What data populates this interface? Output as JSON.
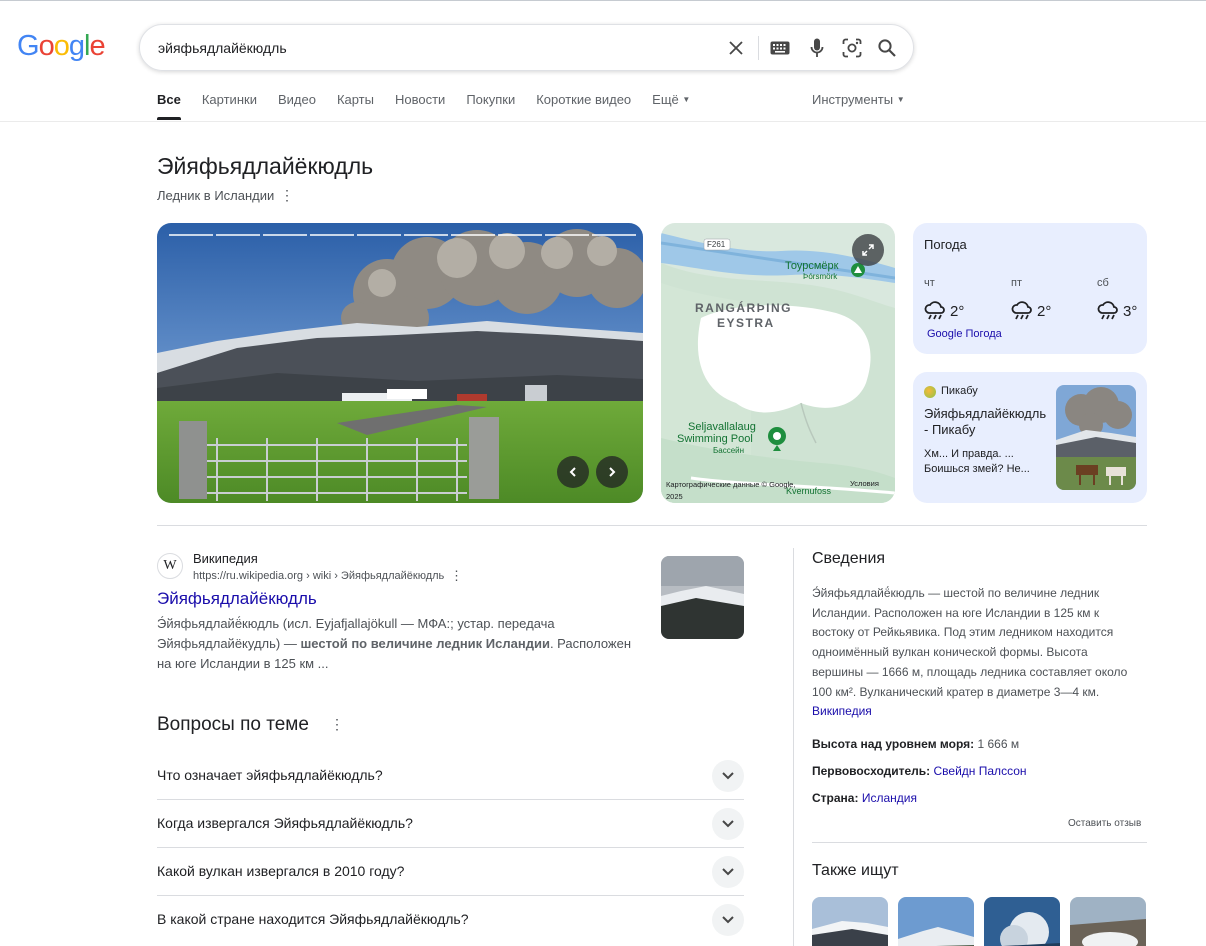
{
  "logo": {
    "letters": [
      "G",
      "o",
      "o",
      "g",
      "l",
      "e"
    ],
    "colors": [
      "#4285F4",
      "#EA4335",
      "#FBBC05",
      "#4285F4",
      "#34A853",
      "#EA4335"
    ]
  },
  "search": {
    "query": "эйяфьядлайёкюдль"
  },
  "tabs": [
    "Все",
    "Картинки",
    "Видео",
    "Карты",
    "Новости",
    "Покупки",
    "Короткие видео",
    "Ещё"
  ],
  "tools_label": "Инструменты",
  "knowledge_panel": {
    "title": "Эйяфьядлайёкюдль",
    "subtitle": "Ледник в Исландии"
  },
  "map": {
    "road_label": "F261",
    "place_ru": "Тоурсмёрк",
    "place_is": "Þórsmörk",
    "region_line1": "RANGÁRÞING",
    "region_line2": "EYSTRA",
    "pool_line1": "Seljavallalaug",
    "pool_line2": "Swimming Pool",
    "pool_type": "Бассейн",
    "waterfall": "Kvernufoss",
    "attribution": "Картографические данные © Google, 2025",
    "terms": "Условия"
  },
  "weather": {
    "title": "Погода",
    "days": [
      {
        "day": "чт",
        "temp": "2°"
      },
      {
        "day": "пт",
        "temp": "2°"
      },
      {
        "day": "сб",
        "temp": "3°"
      }
    ],
    "link": "Google Погода"
  },
  "pikabu": {
    "source": "Пикабу",
    "title": "Эйяфьядлайёкюдль - Пикабу",
    "snippet": "Хм... И правда. ... Боишься змей? Не..."
  },
  "wiki_result": {
    "site": "Википедия",
    "url": "https://ru.wikipedia.org › wiki › Эйяфьядлайёкюдль",
    "title": "Эйяфьядлайёкюдль",
    "snippet_a": "Э́йяфьядлайё́кюдль (исл. Eyjafjallajökull — МФА:; устар. передача Эйяфьядлайёкудль) — ",
    "snippet_bold": "шестой по величине ледник Исландии",
    "snippet_b": ". Расположен на юге Исландии в 125 км ..."
  },
  "paa": {
    "title": "Вопросы по теме",
    "questions": [
      "Что означает эйяфьядлайёкюдль?",
      "Когда извергался Эйяфьядлайёкюдль?",
      "Какой вулкан извергался в 2010 году?",
      "В какой стране находится Эйяфьядлайёкюдль?"
    ]
  },
  "info": {
    "title": "Сведения",
    "description": "Э́йяфьядлайё́кюдль — шестой по величине ледник Исландии. Расположен на юге Исландии в 125 км к востоку от Рейкьявика. Под этим ледником находится одноимённый вулкан конической формы. Высота вершины — 1666 м, площадь ледника составляет около 100 км². Вулканический кратер в диаметре 3—4 км.",
    "source_link": "Википедия",
    "facts": [
      {
        "label": "Высота над уровнем моря:",
        "value": " 1 666 м"
      },
      {
        "label": "Первовосходитель:",
        "value": "Свейдн Палссон"
      },
      {
        "label": "Страна:",
        "value": "Исландия"
      }
    ],
    "feedback": "Оставить отзыв",
    "also_title": "Также ищут"
  }
}
